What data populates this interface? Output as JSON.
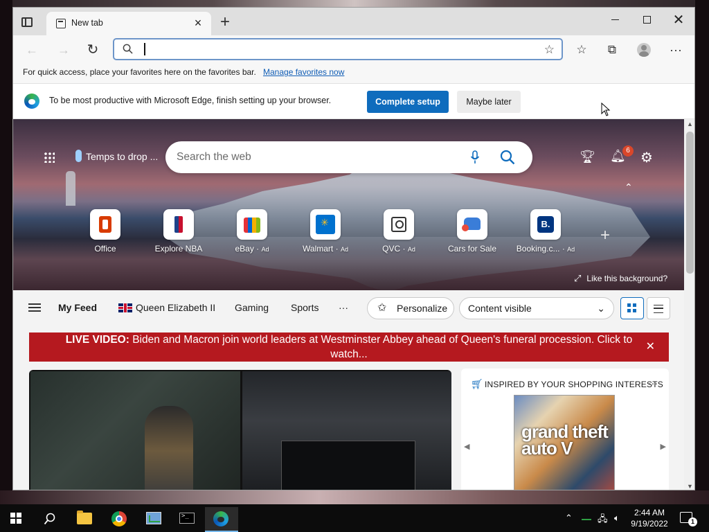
{
  "browser": {
    "tab_title": "New tab",
    "address_value": "",
    "favorites_bar_text": "For quick access, place your favorites here on the favorites bar.",
    "favorites_bar_link": "Manage favorites now"
  },
  "setup_bar": {
    "message": "To be most productive with Microsoft Edge, finish setting up your browser.",
    "complete_label": "Complete setup",
    "later_label": "Maybe later"
  },
  "ntp": {
    "weather_text": "Temps to drop ...",
    "search_placeholder": "Search the web",
    "notification_count": "6",
    "quick_links": [
      {
        "label": "Office",
        "ad": ""
      },
      {
        "label": "Explore NBA",
        "ad": ""
      },
      {
        "label": "eBay",
        "ad": "Ad"
      },
      {
        "label": "Walmart",
        "ad": "Ad"
      },
      {
        "label": "QVC",
        "ad": "Ad"
      },
      {
        "label": "Cars for Sale",
        "ad": ""
      },
      {
        "label": "Booking.c...",
        "ad": "Ad"
      }
    ],
    "like_background": "Like this background?",
    "feed_tabs": [
      "My Feed",
      "Queen Elizabeth II",
      "Gaming",
      "Sports",
      "···"
    ],
    "personalize_label": "Personalize",
    "content_visible_label": "Content visible",
    "live_banner": {
      "prefix": "LIVE VIDEO:",
      "text": "Biden and Macron join world leaders at Westminster Abbey ahead of Queen's funeral procession. Click to watch..."
    },
    "shopping": {
      "title": "INSPIRED BY YOUR SHOPPING INTERESTS",
      "product_logo": "grand theft auto V"
    }
  },
  "taskbar": {
    "time": "2:44 AM",
    "date": "9/19/2022",
    "notification_count": "1"
  },
  "colors": {
    "accent": "#0f6cbd",
    "live_banner": "#b5191f",
    "address_border": "#6d95c9"
  }
}
